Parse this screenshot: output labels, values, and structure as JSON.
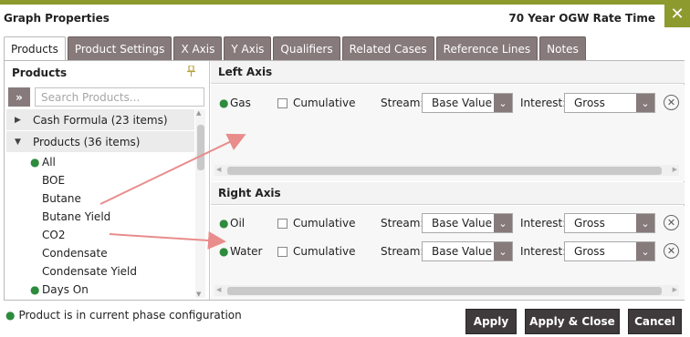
{
  "dialog": {
    "title": "Graph Properties",
    "subtitle": "70 Year OGW Rate Time",
    "close_icon": "✕"
  },
  "tabs": [
    {
      "label": "Products",
      "active": true
    },
    {
      "label": "Product Settings",
      "active": false
    },
    {
      "label": "X Axis",
      "active": false
    },
    {
      "label": "Y Axis",
      "active": false
    },
    {
      "label": "Qualifiers",
      "active": false
    },
    {
      "label": "Related Cases",
      "active": false
    },
    {
      "label": "Reference Lines",
      "active": false
    },
    {
      "label": "Notes",
      "active": false
    }
  ],
  "products_panel": {
    "heading": "Products",
    "pin_icon": "pin-icon",
    "expand_icon": "double-chevron-right-icon",
    "search_placeholder": "Search Products...",
    "groups": [
      {
        "label": "Cash Formula (23 items)",
        "expanded": false
      },
      {
        "label": "Products (36 items)",
        "expanded": true
      }
    ],
    "items": [
      {
        "label": "All",
        "in_phase": true
      },
      {
        "label": "BOE",
        "in_phase": false
      },
      {
        "label": "Butane",
        "in_phase": false
      },
      {
        "label": "Butane Yield",
        "in_phase": false
      },
      {
        "label": "CO2",
        "in_phase": false
      },
      {
        "label": "Condensate",
        "in_phase": false
      },
      {
        "label": "Condensate Yield",
        "in_phase": false
      },
      {
        "label": "Days On",
        "in_phase": true
      }
    ]
  },
  "left_axis": {
    "heading": "Left Axis",
    "rows": [
      {
        "product": "Gas",
        "cumulative_label": "Cumulative",
        "cumulative": false,
        "stream_label": "Stream:",
        "stream": "Base Value",
        "interest_label": "Interest:",
        "interest": "Gross"
      }
    ]
  },
  "right_axis": {
    "heading": "Right Axis",
    "rows": [
      {
        "product": "Oil",
        "cumulative_label": "Cumulative",
        "cumulative": false,
        "stream_label": "Stream:",
        "stream": "Base Value",
        "interest_label": "Interest:",
        "interest": "Gross"
      },
      {
        "product": "Water",
        "cumulative_label": "Cumulative",
        "cumulative": false,
        "stream_label": "Stream:",
        "stream": "Base Value",
        "interest_label": "Interest:",
        "interest": "Gross"
      }
    ]
  },
  "footer": {
    "legend": "Product is in current phase configuration",
    "apply": "Apply",
    "apply_close": "Apply & Close",
    "cancel": "Cancel"
  },
  "colors": {
    "accent": "#8c9a2e",
    "tab": "#877a7b",
    "button": "#3f3a3b",
    "phase_dot": "#2e8b3d",
    "arrow": "#e98c8c"
  }
}
